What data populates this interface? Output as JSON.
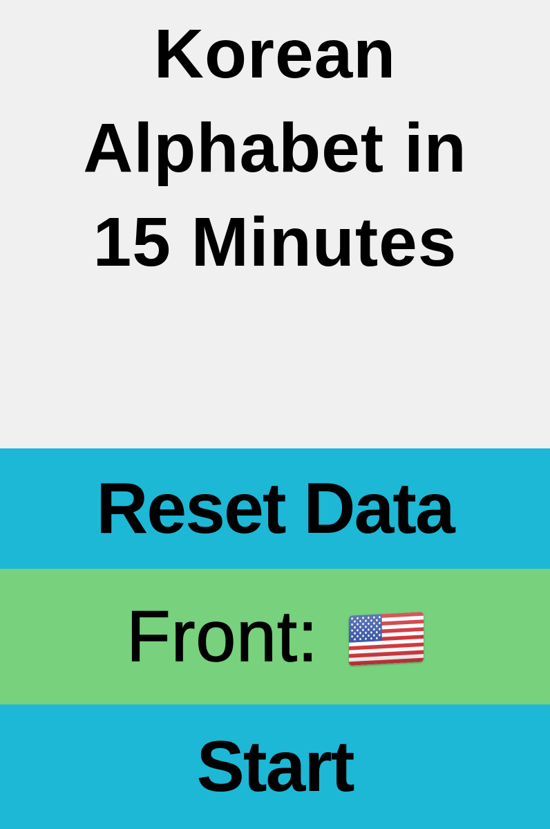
{
  "title": {
    "line1": "Korean",
    "line2": "Alphabet in",
    "line3": "15 Minutes"
  },
  "buttons": {
    "reset_label": "Reset Data",
    "front_label": "Front:",
    "front_flag": "us-flag-icon",
    "start_label": "Start"
  },
  "colors": {
    "background": "#f0f0f0",
    "reset_button": "#1db8d6",
    "front_button": "#77d17d",
    "start_button": "#1db8d6"
  }
}
